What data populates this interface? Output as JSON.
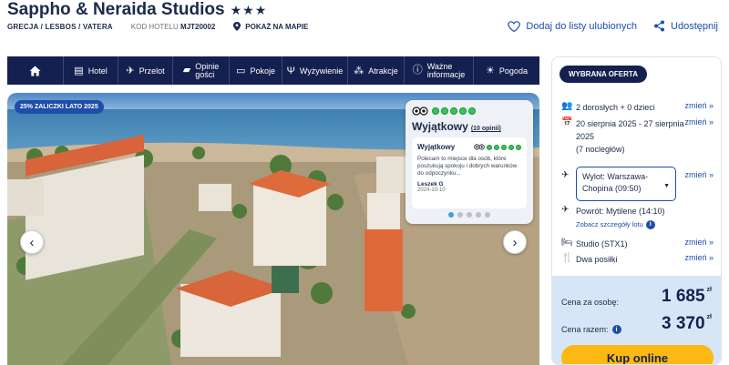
{
  "hotel": {
    "name": "Sappho & Neraida Studios",
    "stars": "★★★",
    "location": "GRECJA / LESBOS / VATERA",
    "code_label": "KOD HOTELU",
    "code": "MJT20002",
    "map_link": "POKAŻ NA MAPIE"
  },
  "actions": {
    "favorite": "Dodaj do listy ulubionych",
    "share": "Udostępnij"
  },
  "nav": [
    {
      "label": "",
      "icon": "home-icon"
    },
    {
      "label": "Hotel",
      "icon": "hotel-icon"
    },
    {
      "label": "Przelot",
      "icon": "plane-icon"
    },
    {
      "label": "Opinie gości",
      "line1": "Opinie",
      "line2": "gości",
      "icon": "chat-icon"
    },
    {
      "label": "Pokoje",
      "icon": "bed-icon"
    },
    {
      "label": "Wyżywienie",
      "icon": "cutlery-icon"
    },
    {
      "label": "Atrakcje",
      "icon": "attractions-icon"
    },
    {
      "label": "Ważne informacje",
      "line1": "Ważne",
      "line2": "informacje",
      "icon": "info-icon"
    },
    {
      "label": "Pogoda",
      "icon": "sun-icon"
    }
  ],
  "gallery": {
    "promo": "25% ZALICZKI LATO 2025",
    "prev": "‹",
    "next": "›"
  },
  "review": {
    "rating_label": "Wyjątkowy",
    "opinions": "(10 opinii)",
    "card_title": "Wyjątkowy",
    "text": "Polecam to miejsce dla osób, które poszukują spokoju i dobrych warunków do odpoczynku...",
    "author": "Leszek G",
    "date": "2024-10-10",
    "bubbles": 5,
    "slides": 5,
    "active_slide": 1
  },
  "offer": {
    "badge": "WYBRANA OFERTA",
    "change": "zmień »",
    "travelers": "2 dorosłych + 0 dzieci",
    "dates": "20 sierpnia 2025 - 27 sierpnia 2025",
    "nights": "(7 nocległów)",
    "outbound": "Wylot: Warszawa-Chopina (09:50)",
    "return": "Powrót: Mytilene (14:10)",
    "flight_details": "Zobacz szczegóły lotu",
    "room": "Studio (STX1)",
    "board": "Dwa posiłki",
    "price_per_person_label": "Cena za osobę:",
    "price_per_person": "1 685",
    "total_label": "Cena razem:",
    "total": "3 370",
    "currency": "zł",
    "buy": "Kup online"
  },
  "colors": {
    "navy": "#14204f",
    "link": "#1e4ea8",
    "cta": "#fcb813",
    "price_bg": "#d7e6f7"
  }
}
